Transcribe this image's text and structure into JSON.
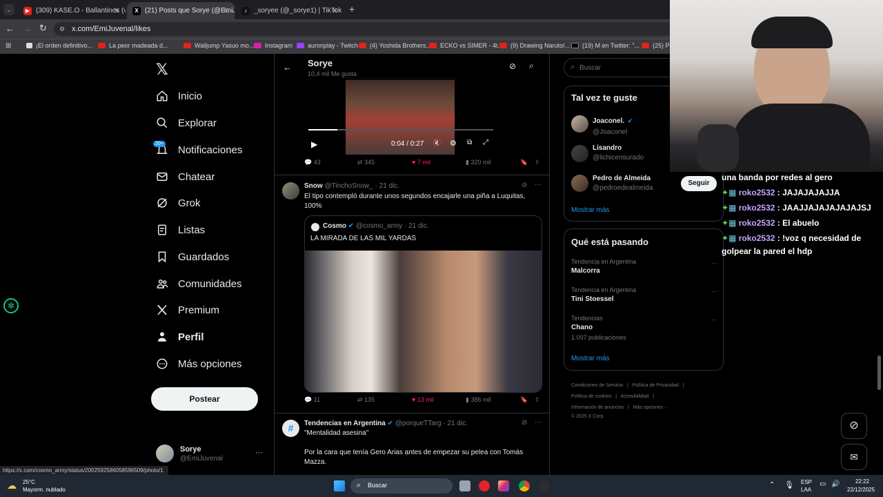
{
  "browser": {
    "tabs": [
      {
        "title": "(309) KASE.O - Ballantines (vers"
      },
      {
        "title": "(21) Posts que Sorye (@EmiJuve"
      },
      {
        "title": "_soryee (@_sorye1) | TikTok"
      }
    ],
    "new_tab": "+",
    "url": "x.com/EmiJuvenal/likes",
    "bookmarks": [
      "¡El orden definitivo...",
      "La peor madeada d...",
      "Walljump Yasuo mo...",
      "Instagram",
      "auronplay - Twitch",
      "(4) Yoshida Brothers...",
      "ECKO vs SIMER - 4t...",
      "(9) Drawing Naruto/...",
      "(19) M en Twitter: \"...",
      "(25) Pac"
    ],
    "status_url": "https://x.com/cosmo_army/status/2002592586058596509/photo/1"
  },
  "nav": {
    "items": [
      {
        "label": "Inicio"
      },
      {
        "label": "Explorar"
      },
      {
        "label": "Notificaciones",
        "badge": "20+"
      },
      {
        "label": "Chatear"
      },
      {
        "label": "Grok"
      },
      {
        "label": "Listas"
      },
      {
        "label": "Guardados"
      },
      {
        "label": "Comunidades"
      },
      {
        "label": "Premium"
      },
      {
        "label": "Perfil"
      },
      {
        "label": "Más opciones"
      }
    ],
    "post_button": "Postear",
    "account": {
      "name": "Sorye",
      "handle": "@EmiJuvenal",
      "more": "···"
    }
  },
  "timeline": {
    "header": {
      "title": "Sorye",
      "subtitle": "10,4 mil Me gusta"
    },
    "post1": {
      "video_time": "0:04 / 0:27",
      "replies": "43",
      "reposts": "345",
      "likes": "7 mil",
      "views": "320 mil"
    },
    "post2": {
      "name": "Snow",
      "handle": "@TinchoSnow_",
      "date": "· 21 dic.",
      "text": "El tipo contempló durante unos segundos encajarle una piña a Luquitas, 100%",
      "quote": {
        "name": "Cosmo",
        "handle": "@cosmo_army",
        "date": "· 21 dic.",
        "text": "LA MIRADA DE LAS MIL YARDAS"
      },
      "replies": "11",
      "reposts": "135",
      "likes": "13 mil",
      "views": "386 mil"
    },
    "post3": {
      "name": "Tendencias en Argentina",
      "handle": "@porqueTTarg",
      "date": "· 21 dic.",
      "line1": "\"Mentalidad asesina\"",
      "line2": "Por la cara que tenía Gero Arias antes de empezar su pelea con Tomás Mazza."
    }
  },
  "right": {
    "search_placeholder": "Buscar",
    "suggest": {
      "title": "Tal vez te guste",
      "users": [
        {
          "name": "Joaconel.",
          "handle": "@Joaconel"
        },
        {
          "name": "Lisandro",
          "handle": "@lichicensurado"
        },
        {
          "name": "Pedro de Almeida",
          "handle": "@pedroedealmeida"
        }
      ],
      "follow": "Seguir",
      "more": "Mostrar más"
    },
    "trends": {
      "title": "Qué está pasando",
      "items": [
        {
          "context": "Tendencia en Argentina",
          "name": "Malcorra",
          "count": ""
        },
        {
          "context": "Tendencia en Argentina",
          "name": "Tini Stoessel",
          "count": ""
        },
        {
          "context": "Tendencias",
          "name": "Chano",
          "count": "1.097 publicaciones"
        }
      ],
      "more": "Mostrar más"
    },
    "footer": [
      "Condiciones de Servicio",
      "|",
      "Política de Privacidad",
      "|",
      "Política de cookies",
      "|",
      "Accesibilidad",
      "|",
      "Información de anuncios",
      "|",
      "Más opciones ···",
      "© 2025 X Corp."
    ]
  },
  "chat": {
    "lines": [
      {
        "user": "",
        "text": "una banda por redes al gero"
      },
      {
        "user": "roko2532",
        "text": ": JAJAJAJAJJA"
      },
      {
        "user": "roko2532",
        "text": ": JAAJJAJAJAJAJAJSJ"
      },
      {
        "user": "roko2532",
        "text": ": El abuelo"
      },
      {
        "user": "roko2532",
        "text": ": !voz q necesidad de"
      },
      {
        "user": "",
        "text": "golpear la pared el hdp"
      }
    ]
  },
  "taskbar": {
    "weather_temp": "25°C",
    "weather_desc": "Mayorm. nublado",
    "search": "Buscar",
    "lang1": "ESP",
    "lang2": "LAA",
    "time": "22:22",
    "date": "22/12/2025"
  },
  "colors": {
    "accent": "#1d9bf0",
    "like": "#f91880",
    "chat_name": "#c7a6ff"
  }
}
